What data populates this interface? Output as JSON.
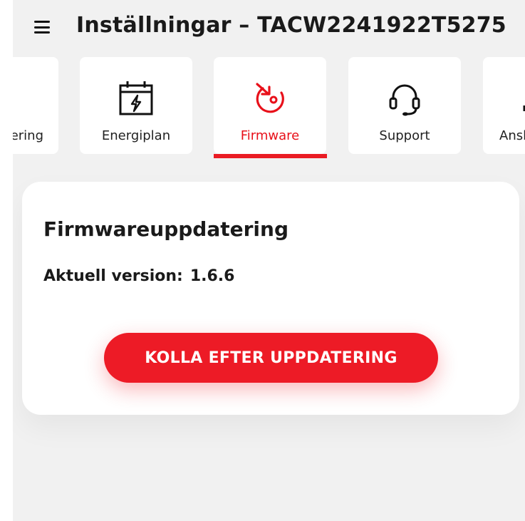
{
  "header": {
    "title": "Inställningar – TACW2241922T5275",
    "menu_icon": "hamburger-menu-icon"
  },
  "tabs": [
    {
      "label": "ering",
      "icon": "unknown",
      "active": false,
      "partial": "left"
    },
    {
      "label": "Energiplan",
      "icon": "calendar-bolt-icon",
      "active": false
    },
    {
      "label": "Firmware",
      "icon": "firmware-update-icon",
      "active": true
    },
    {
      "label": "Support",
      "icon": "headset-icon",
      "active": false
    },
    {
      "label": "Ansl",
      "icon": "unknown",
      "active": false,
      "partial": "right"
    }
  ],
  "card": {
    "title": "Firmwareuppdatering",
    "version_label": "Aktuell version:",
    "version_value": "1.6.6",
    "button_label": "KOLLA EFTER UPPDATERING"
  },
  "colors": {
    "accent": "#ea1c24",
    "background": "#f1f1f1",
    "card": "#ffffff",
    "text": "#1a1a1a"
  }
}
